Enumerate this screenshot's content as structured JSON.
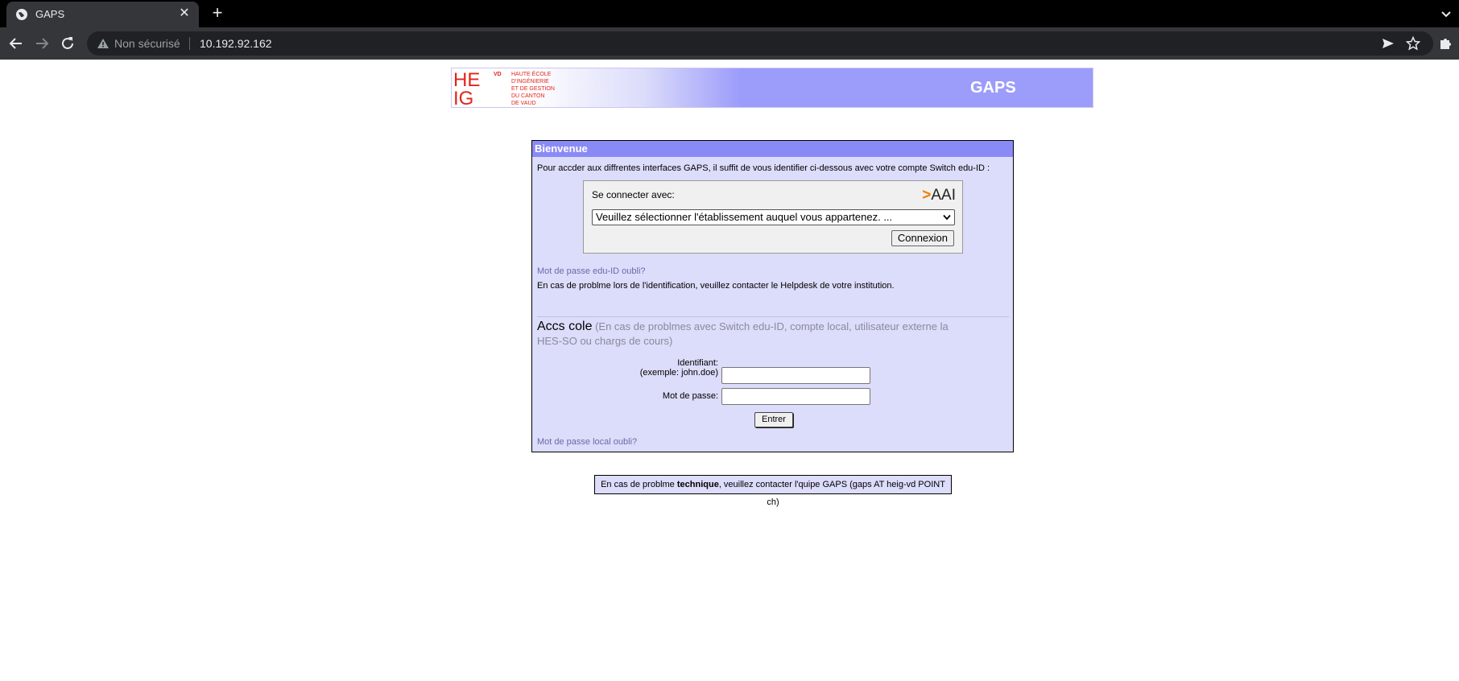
{
  "browser": {
    "tab_title": "GAPS",
    "security_label": "Non sécurisé",
    "url": "10.192.92.162",
    "icons": [
      "globe-icon",
      "close-icon",
      "plus-icon",
      "chevron-down-icon",
      "back-arrow-icon",
      "forward-arrow-icon",
      "reload-icon",
      "warning-icon",
      "send-icon",
      "star-icon",
      "puzzle-icon"
    ]
  },
  "banner": {
    "logo_letters": "HEIG",
    "logo_vd": "VD",
    "logo_lines": [
      "HAUTE ÉCOLE",
      "D'INGÉNIERIE",
      "ET DE GESTION",
      "DU CANTON",
      "DE VAUD"
    ],
    "title": "GAPS"
  },
  "panel": {
    "heading": "Bienvenue",
    "intro": "Pour accder aux diffrentes interfaces GAPS, il suffit de vous identifier ci-dessous avec votre compte Switch edu-ID :",
    "aai": {
      "label": "Se connecter avec:",
      "logo_text": "AAI",
      "select_value": "Veuillez sélectionner l'établissement auquel vous appartenez. ...",
      "button": "Connexion"
    },
    "edu_forgot": "Mot de passe edu-ID oubli?",
    "problem": "En cas de problme lors de l'identification, veuillez contacter le Helpdesk de votre institution.",
    "local": {
      "title": "Accs cole",
      "subtitle": "(En cas de problmes avec Switch edu-ID, compte local, utilisateur externe la HES-SO ou chargs de cours)",
      "user_label_1": "Identifiant:",
      "user_label_2": "(exemple: john.doe)",
      "pass_label": "Mot de passe:",
      "submit": "Entrer",
      "forgot": "Mot de passe local oubli?"
    }
  },
  "footer": {
    "prefix": "En cas de problme ",
    "strong": "technique",
    "suffix": ", veuillez contacter l'quipe GAPS (gaps AT heig-vd POINT ch)"
  },
  "colors": {
    "panel_bg": "#dcdcfb",
    "panel_header": "#8a8af7",
    "banner_accent": "#9c9cfb",
    "logo_red": "#e1251b",
    "link": "#6a6aa8"
  }
}
